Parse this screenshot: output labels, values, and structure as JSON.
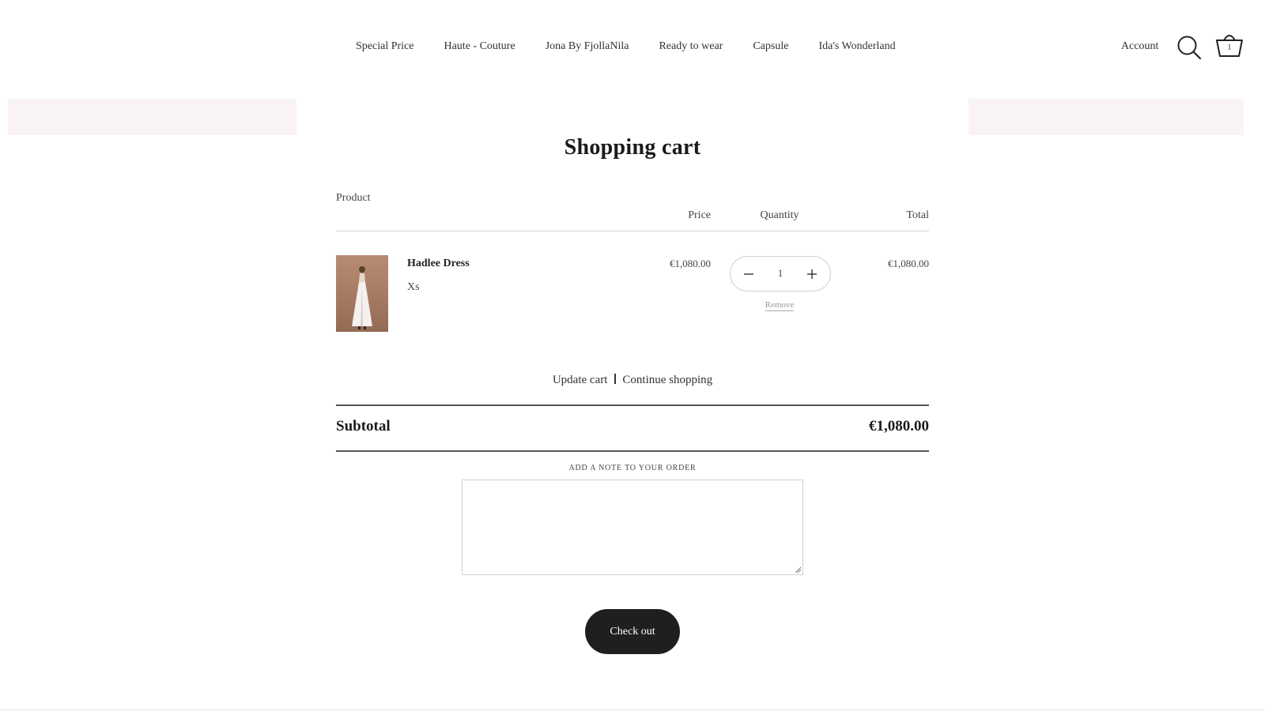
{
  "nav": {
    "items": [
      {
        "label": "Special Price"
      },
      {
        "label": "Haute - Couture"
      },
      {
        "label": "Jona By FjollaNila"
      },
      {
        "label": "Ready to wear"
      },
      {
        "label": "Capsule"
      },
      {
        "label": "Ida's Wonderland"
      }
    ],
    "account_label": "Account",
    "search_icon": "search-icon",
    "cart_icon": "cart-icon",
    "cart_count": "1"
  },
  "cart": {
    "title": "Shopping cart",
    "columns": {
      "product": "Product",
      "price": "Price",
      "quantity": "Quantity",
      "total": "Total"
    },
    "items": [
      {
        "name": "Hadlee Dress",
        "variant": "Xs",
        "price": "€1,080.00",
        "quantity": "1",
        "remove_label": "Remove",
        "total": "€1,080.00"
      }
    ],
    "update_label": "Update cart",
    "continue_label": "Continue shopping",
    "subtotal_label": "Subtotal",
    "subtotal_value": "€1,080.00",
    "note_label": "ADD A NOTE TO YOUR ORDER",
    "note_value": "",
    "checkout_label": "Check out"
  },
  "colors": {
    "accent_dark": "#1f1f1f",
    "pale_block": "#f9f4f3",
    "text": "#222222"
  }
}
